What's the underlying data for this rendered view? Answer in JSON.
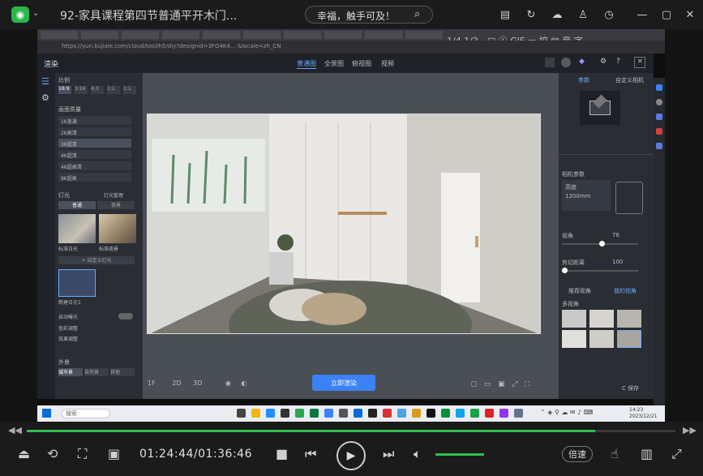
{
  "player": {
    "title": "92-家具课程第四节普通平开木门...",
    "search_text": "幸福，触手可及！",
    "current_time": "01:24:44",
    "duration": "01:36:46",
    "time_display": "01:24:44/01:36:46",
    "progress": 0.876,
    "volume": 0.6,
    "speed_label": "倍速",
    "accent": "#2fbf4f"
  },
  "video_overlay": {
    "numbers": "1/4   1/2   -   □   Ⓘ   GIF   ▭   控   ▤   音   字"
  },
  "app": {
    "name": "渲染",
    "view_tabs": [
      "普通图",
      "全景图",
      "俯视图",
      "视频"
    ],
    "left_panel": {
      "section_scale": "比例",
      "ratios": [
        "16:9",
        "3:16",
        "4:3",
        "1:1",
        "1:1"
      ],
      "section_quality": "画面质量",
      "quality_rows": [
        "1K普通",
        "2K高清",
        "3K超清",
        "4K超清",
        "4K超高清",
        "8K超高"
      ],
      "section_light": "灯光",
      "light_manage": "灯光管理",
      "light_tabs": [
        "普通",
        "夜景"
      ],
      "presets": [
        "标准日光",
        "标准夜景"
      ],
      "custom_btn": "+ 自定义灯光",
      "custom_preset": "新建日光1",
      "toggle_label": "自动曝光",
      "links": [
        "色彩调整",
        "效果调整"
      ],
      "section_bottom": "外景",
      "bottom_tabs": [
        "城市景",
        "自然景",
        "其他"
      ]
    },
    "viewport": {
      "render_btn": "立即渲染",
      "tools": [
        "1F",
        "2D",
        "3D"
      ]
    },
    "right_panel": {
      "tabs": [
        "参数",
        "自定义相机"
      ],
      "camera_label": "相机参数",
      "height_label": "高度",
      "height_value": "1200mm",
      "fov_label": "视角",
      "fov_value": "76",
      "clip_label": "剪切距离",
      "clip_value": "100",
      "presets_label": "推荐视角",
      "mine_label": "我的视角",
      "view_label": "多视角",
      "save_btn": "C 保存"
    },
    "url": "https://yun.kujiale.com/cloud/tool/h5/diy?designid=3FO4K4... &locale=zh_CN"
  },
  "taskbar": {
    "search": "搜索",
    "clock_time": "14:23",
    "clock_date": "2023/12/21"
  }
}
